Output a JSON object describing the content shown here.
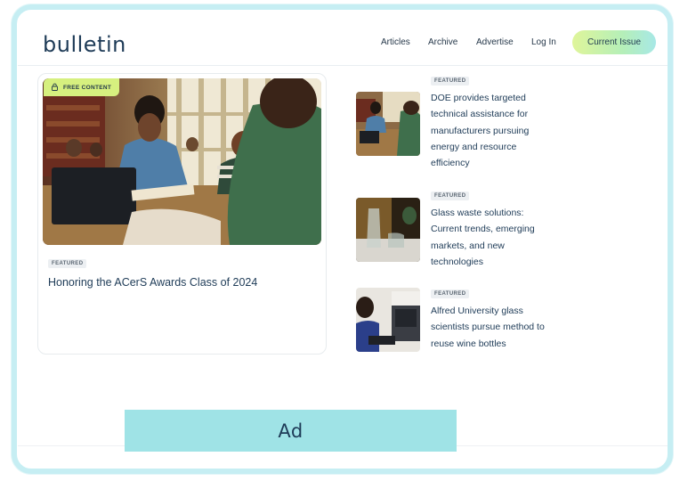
{
  "brand": {
    "logo": "bulletin"
  },
  "nav": {
    "items": [
      {
        "label": "Articles"
      },
      {
        "label": "Archive"
      },
      {
        "label": "Advertise"
      },
      {
        "label": "Log In"
      }
    ],
    "cta": "Current Issue"
  },
  "main_article": {
    "badge": "FREE CONTENT",
    "tag": "FEATURED",
    "title": "Honoring the ACerS Awards Class of 2024"
  },
  "side_articles": [
    {
      "tag": "FEATURED",
      "title": "DOE provides targeted technical assistance for manufacturers pursuing energy and resource efficiency"
    },
    {
      "tag": "FEATURED",
      "title": "Glass waste solutions: Current trends, emerging markets, and new technologies"
    },
    {
      "tag": "FEATURED",
      "title": "Alfred University glass scientists pursue method to reuse wine bottles"
    }
  ],
  "ad": {
    "label": "Ad"
  },
  "colors": {
    "brand_text": "#1e3b57",
    "cta_gradient_start": "#dff59a",
    "cta_gradient_end": "#a7e8e6",
    "badge": "#d6f07f",
    "ad_background": "#9fe3e6",
    "frame": "#c6eef3"
  },
  "icons": {
    "badge_icon": "lock-icon"
  }
}
